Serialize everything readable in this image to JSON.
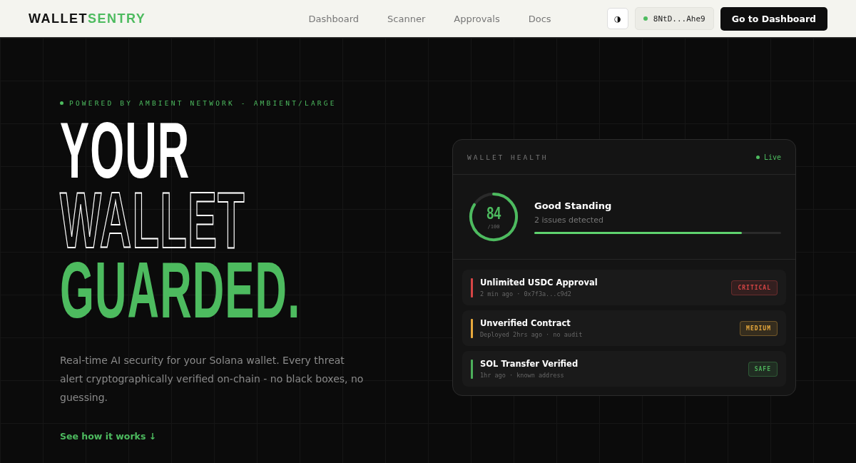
{
  "nav": {
    "brand": {
      "primary": "WALLET",
      "accent": "SENTRY"
    },
    "links": [
      {
        "label": "Dashboard"
      },
      {
        "label": "Scanner"
      },
      {
        "label": "Approvals"
      },
      {
        "label": "Docs"
      }
    ],
    "theme_toggle": {
      "icon": "◑"
    },
    "wallet": {
      "address": "8NtD...Ahe9",
      "connected": true
    },
    "cta": "Go to Dashboard"
  },
  "hero": {
    "eyebrow": "POWERED BY AMBIENT NETWORK - AMBIENT/LARGE",
    "headline": [
      {
        "text": "YOUR",
        "kind": "solid"
      },
      {
        "text": "WALLET",
        "kind": "outline"
      },
      {
        "text": "GUARDED.",
        "kind": "accent"
      }
    ],
    "description": "Real-time AI security for your Solana wallet. Every threat alert cryptographically verified on-chain - no black boxes, no guessing.",
    "link": "See how it works ↓"
  },
  "health_card": {
    "title": "WALLET HEALTH",
    "live": "Live",
    "score": {
      "value": "84",
      "max": "/100"
    },
    "status": "Good Standing",
    "issues": "2 issues detected",
    "progress": {
      "level": 0.84
    },
    "alerts": [
      {
        "title": "Unlimited USDC Approval",
        "detail": "2 min ago · 0x7f3a...c9d2",
        "badge": "CRITICAL",
        "color": "#d64545"
      },
      {
        "title": "Unverified Contract",
        "detail": "Deployed 2hrs ago · no audit",
        "badge": "MEDIUM",
        "color": "#e8a93c"
      },
      {
        "title": "SOL Transfer Verified",
        "detail": "1hr ago · known address",
        "badge": "SAFE",
        "color": "#4caf5a"
      }
    ]
  }
}
